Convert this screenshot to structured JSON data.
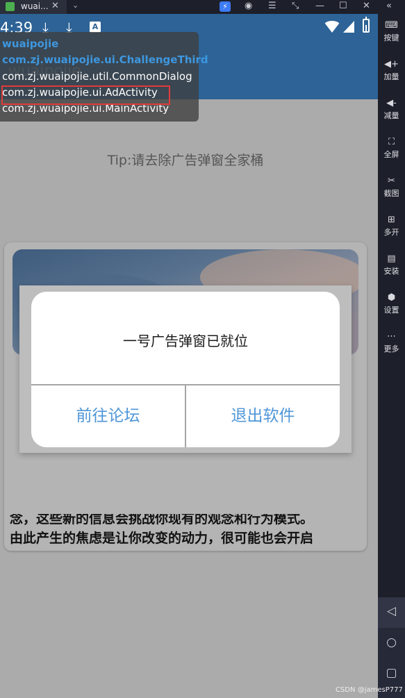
{
  "window": {
    "tab_title": "wuai...",
    "tab_close": "✕",
    "tab_menu": "⌄",
    "controls": [
      "☰",
      "⤡",
      "—",
      "☐",
      "✕",
      "«"
    ]
  },
  "sidebar": {
    "items": [
      {
        "icon": "keyboard-icon",
        "glyph": "⌨",
        "label": "按键"
      },
      {
        "icon": "volume-up-icon",
        "glyph": "◀+",
        "label": "加量"
      },
      {
        "icon": "volume-down-icon",
        "glyph": "◀-",
        "label": "减量"
      },
      {
        "icon": "fullscreen-icon",
        "glyph": "⛶",
        "label": "全屏"
      },
      {
        "icon": "scissors-icon",
        "glyph": "✂",
        "label": "截图"
      },
      {
        "icon": "multi-open-icon",
        "glyph": "⊞",
        "label": "多开"
      },
      {
        "icon": "apk-install-icon",
        "glyph": "▤",
        "label": "安装"
      },
      {
        "icon": "settings-icon",
        "glyph": "⬢",
        "label": "设置"
      },
      {
        "icon": "more-icon",
        "glyph": "⋯",
        "label": "更多"
      }
    ],
    "nav": {
      "back": "◁",
      "home": "○",
      "recents": "▢"
    }
  },
  "status_bar": {
    "time": "4:39",
    "download_glyph": "⤓",
    "app_badge": "A"
  },
  "app": {
    "title": "wuaipojie",
    "tip": "Tip:请去除广告弹窗全家桶"
  },
  "card": {
    "line1": "念，这些新的信息会挑战你现有的观念和行为模式。",
    "line2": "由此产生的焦虑是让你改变的动力，很可能也会开启"
  },
  "dialog": {
    "message": "一号广告弹窗已就位",
    "buttons": {
      "forum": "前往论坛",
      "exit": "退出软件"
    }
  },
  "activity_overlay": {
    "package": "wuaipojie",
    "top_activity": "com.zj.wuaipojie.ui.ChallengeThird",
    "activities": [
      "com.zj.wuaipojie.util.CommonDialog",
      "com.zj.wuaipojie.ui.AdActivity",
      "com.zj.wuaipojie.ui.MainActivity"
    ],
    "highlight_color": "#e23b3b"
  },
  "watermark": "CSDN @jamesP777",
  "colors": {
    "appbar": "#2d6396",
    "accent_blue": "#4f96d8",
    "sidebar_bg": "#1d1f2a"
  }
}
